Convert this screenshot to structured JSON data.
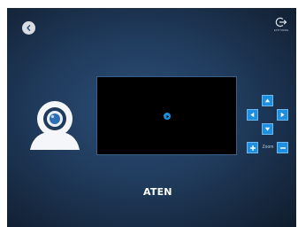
{
  "exit": {
    "label": "EXIT MODE"
  },
  "zoom": {
    "label": "Zoom"
  },
  "brand": {
    "name": "ATEN"
  },
  "icons": {
    "back": "chevron-left-icon",
    "exit": "sign-out-icon",
    "webcam": "webcam-icon",
    "play": "play-icon",
    "up": "arrow-up-icon",
    "down": "arrow-down-icon",
    "left": "arrow-left-icon",
    "right": "arrow-right-icon",
    "zoom_in": "plus-icon",
    "zoom_out": "minus-icon"
  },
  "colors": {
    "accent": "#1e8fe0",
    "background": "#1f3a5b",
    "video_bg": "#000000"
  }
}
